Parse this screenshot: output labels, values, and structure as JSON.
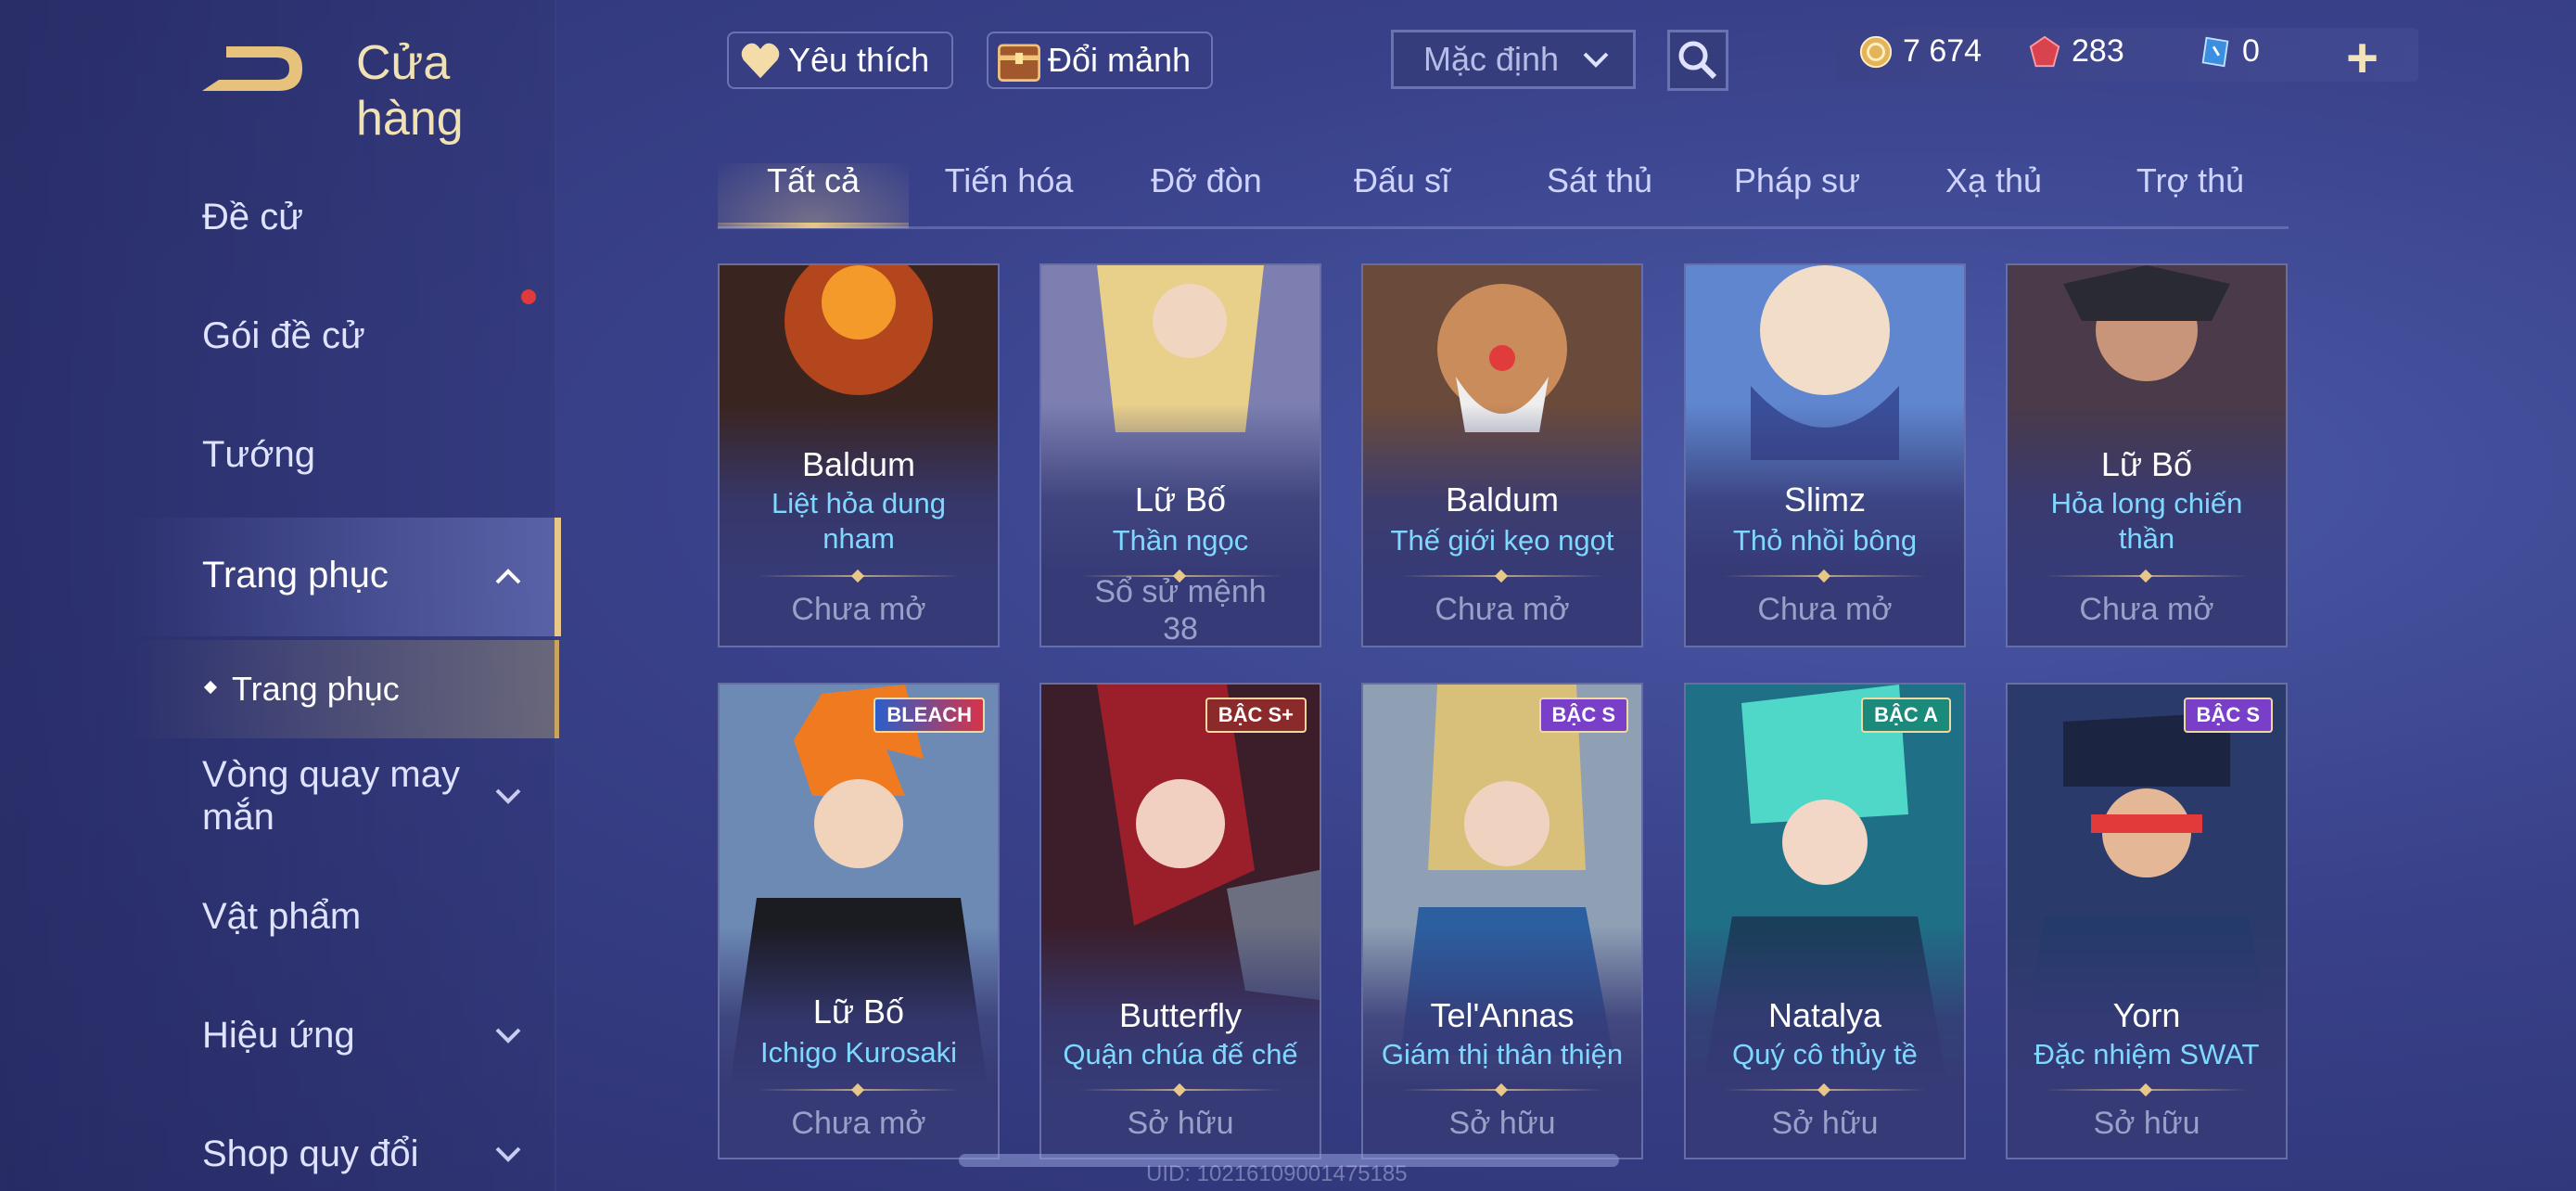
{
  "header": {
    "title": "Cửa hàng",
    "favorites_label": "Yêu thích",
    "exchange_label": "Đổi mảnh",
    "sort_label": "Mặc định"
  },
  "currency": {
    "gold": "7 674",
    "ruby": "283",
    "voucher": "0"
  },
  "sidebar": {
    "items": [
      {
        "label": "Đề cử"
      },
      {
        "label": "Gói đề cử"
      },
      {
        "label": "Tướng"
      },
      {
        "label": "Trang phục"
      },
      {
        "label": "Trang phục"
      },
      {
        "label": "Vòng quay may mắn"
      },
      {
        "label": "Vật phẩm"
      },
      {
        "label": "Hiệu ứng"
      },
      {
        "label": "Shop quy đổi"
      }
    ]
  },
  "tabs": [
    "Tất cả",
    "Tiến hóa",
    "Đỡ đòn",
    "Đấu sĩ",
    "Sát thủ",
    "Pháp sư",
    "Xạ thủ",
    "Trợ thủ"
  ],
  "cards": [
    {
      "hero": "Baldum",
      "skin_line1": "Liệt hỏa dung",
      "skin_line2": "nham",
      "status": "Chưa mở",
      "status2": ""
    },
    {
      "hero": "Lữ Bố",
      "skin_line1": "Thần ngọc",
      "skin_line2": "",
      "status": "Sổ sử mệnh",
      "status2": "38"
    },
    {
      "hero": "Baldum",
      "skin_line1": "Thế giới kẹo ngọt",
      "skin_line2": "",
      "status": "Chưa mở",
      "status2": ""
    },
    {
      "hero": "Slimz",
      "skin_line1": "Thỏ nhồi bông",
      "skin_line2": "",
      "status": "Chưa mở",
      "status2": ""
    },
    {
      "hero": "Lữ Bố",
      "skin_line1": "Hỏa long chiến",
      "skin_line2": "thần",
      "status": "Chưa mở",
      "status2": ""
    },
    {
      "hero": "Lữ Bố",
      "skin_line1": "Ichigo Kurosaki",
      "skin_line2": "",
      "status": "Chưa mở",
      "status2": "",
      "badge": "BLEACH"
    },
    {
      "hero": "Butterfly",
      "skin_line1": "Quận chúa đế chế",
      "skin_line2": "",
      "status": "Sở hữu",
      "status2": "",
      "badge": "BẬC S+"
    },
    {
      "hero": "Tel'Annas",
      "skin_line1": "Giám thị thân thiện",
      "skin_line2": "",
      "status": "Sở hữu",
      "status2": "",
      "badge": "BẬC S"
    },
    {
      "hero": "Natalya",
      "skin_line1": "Quý cô thủy tề",
      "skin_line2": "",
      "status": "Sở hữu",
      "status2": "",
      "badge": "BẬC A"
    },
    {
      "hero": "Yorn",
      "skin_line1": "Đặc nhiệm SWAT",
      "skin_line2": "",
      "status": "Sở hữu",
      "status2": "",
      "badge": "BẬC S"
    }
  ],
  "footer": {
    "uid": "UID: 102161090014751​85"
  },
  "colors": {
    "accent_gold": "#e8c888",
    "skin_name": "#7fd8ff",
    "background": "#39418a"
  }
}
